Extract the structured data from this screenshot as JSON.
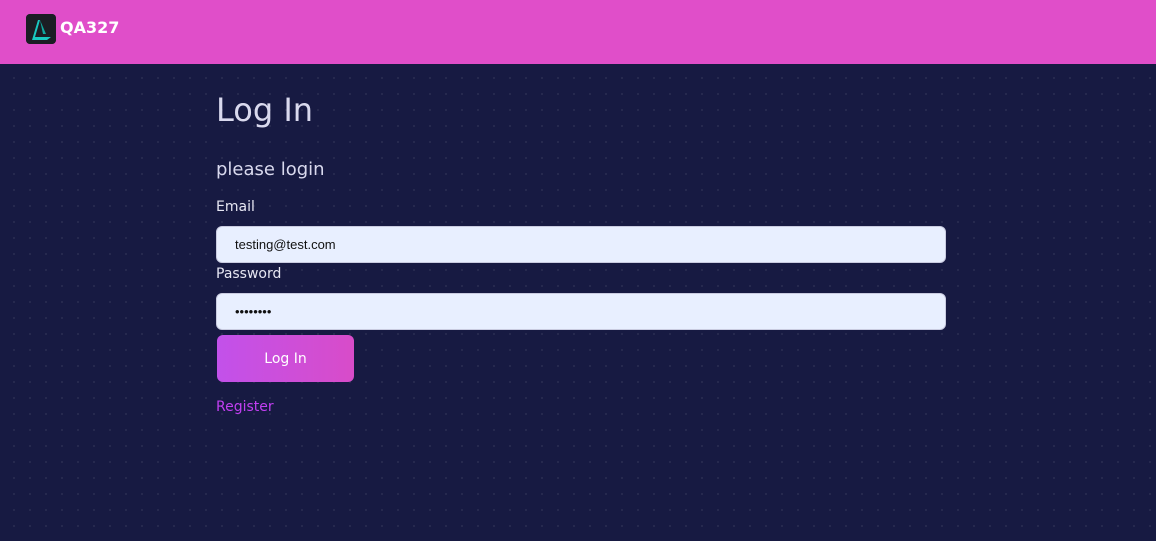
{
  "header": {
    "brand_name": "QA327",
    "logo_icon": "triangle-logo-icon",
    "background_color": "#e04ec9"
  },
  "main": {
    "title": "Log In",
    "subtitle": "please login",
    "email": {
      "label": "Email",
      "value": "testing@test.com"
    },
    "password": {
      "label": "Password",
      "value": "••••••••"
    },
    "login_button_label": "Log In",
    "register_link_label": "Register"
  },
  "colors": {
    "page_background": "#171a42",
    "accent": "#c251ea",
    "link": "#c23ff2",
    "input_background": "#e8efff"
  }
}
